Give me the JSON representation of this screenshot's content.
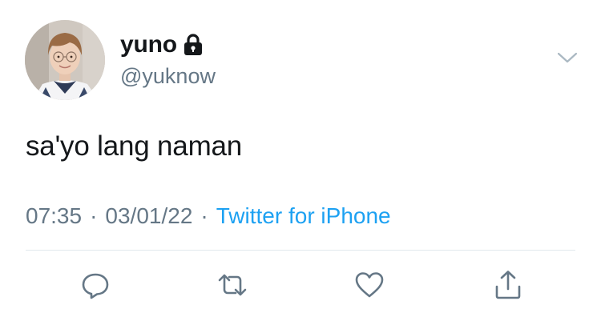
{
  "user": {
    "display_name": "yuno",
    "handle": "@yuknow",
    "protected_icon": "lock-icon",
    "avatar_icon": "profile-photo"
  },
  "tweet": {
    "text": "sa'yo lang naman",
    "time": "07:35",
    "date": "03/01/22",
    "separator": "·",
    "source": "Twitter for iPhone"
  },
  "actions": {
    "menu_icon": "chevron-down-icon",
    "reply_icon": "reply-icon",
    "retweet_icon": "retweet-icon",
    "like_icon": "heart-icon",
    "share_icon": "share-icon"
  },
  "colors": {
    "text": "#14171a",
    "secondary": "#657786",
    "link": "#1da1f2",
    "divider": "#e1e8ed",
    "icon": "#657786"
  }
}
